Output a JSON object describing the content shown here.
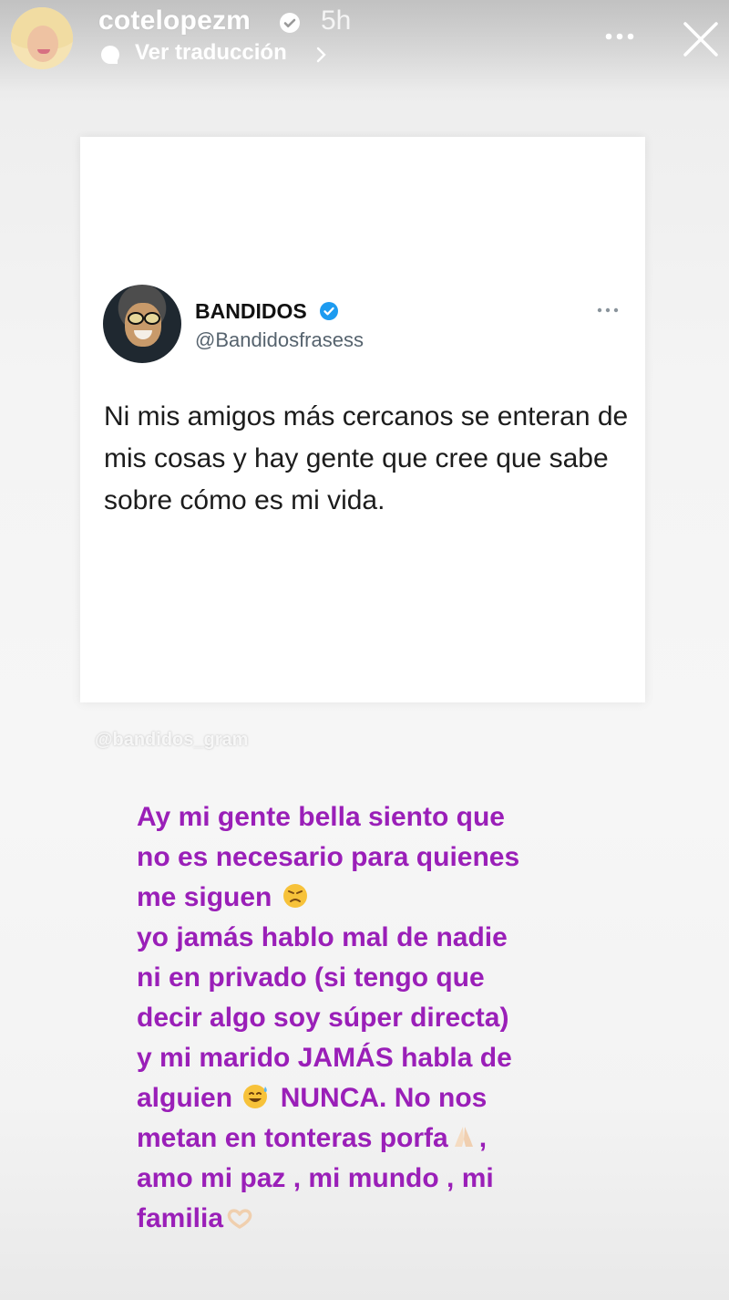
{
  "header": {
    "username": "cotelopezm",
    "time": "5h",
    "translate_label": "Ver traducción"
  },
  "tweet": {
    "name": "BANDIDOS",
    "handle": "@Bandidosfrasess",
    "text": "Ni mis amigos más cercanos se enteran de mis cosas y hay gente que cree que sabe sobre cómo es mi vida."
  },
  "watermark": "@bandidos_gram",
  "caption": {
    "lines": [
      "Ay mi gente bella  siento que",
      "no es necesario para quienes",
      "me siguen",
      "yo jamás hablo mal de nadie",
      "ni en privado (si tengo que",
      "decir algo soy súper directa)",
      "y mi marido JAMÁS habla de",
      "alguien",
      "NUNCA.  No nos",
      "metan en tonteras  porfa",
      ",",
      "amo mi paz , mi mundo , mi",
      "familia"
    ]
  },
  "colors": {
    "caption": "#9a1fb8",
    "verified": "#1d9bf0"
  },
  "icons": [
    "verified-icon",
    "translate-icon",
    "chevron-right-icon",
    "more-icon",
    "close-icon",
    "angry-emoji",
    "sweat-smile-emoji",
    "praying-hands-emoji",
    "heart-hands-emoji"
  ]
}
